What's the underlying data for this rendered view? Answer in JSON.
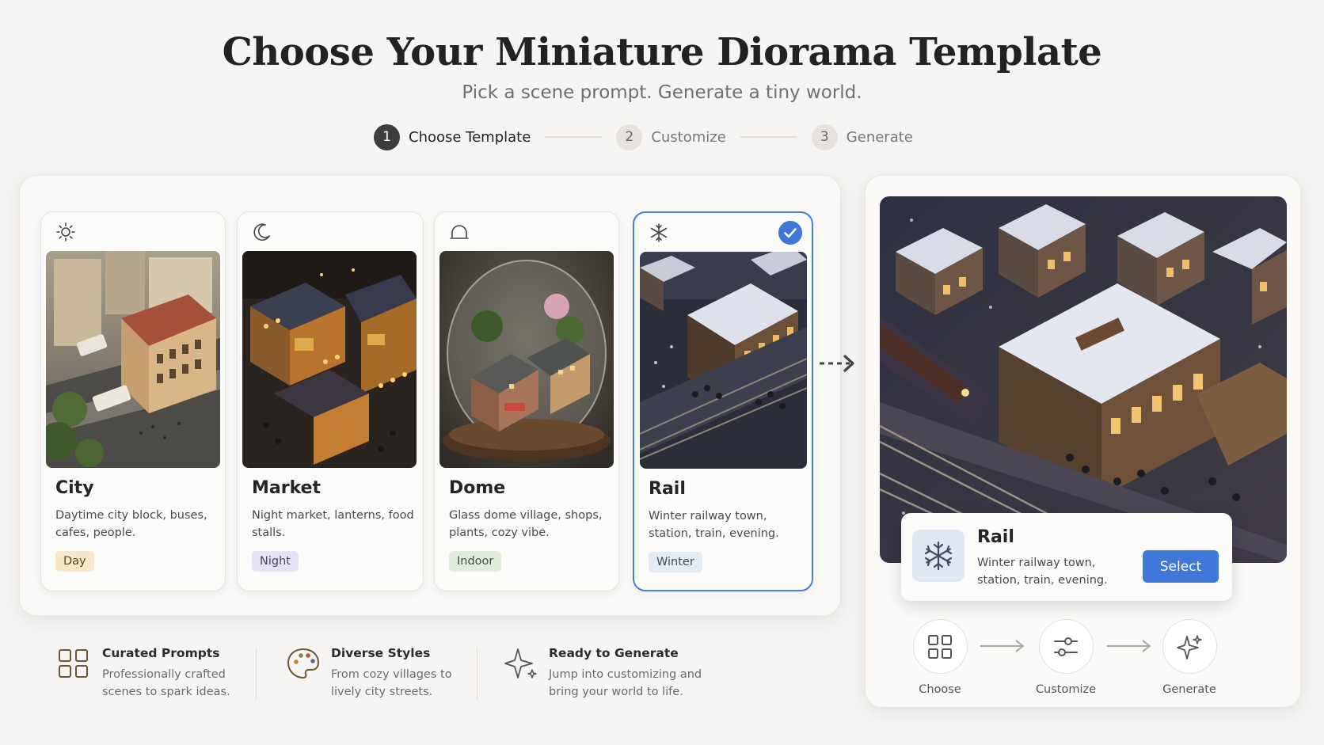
{
  "header": {
    "title": "Choose Your Miniature Diorama Template",
    "subtitle": "Pick a scene prompt. Generate a tiny world."
  },
  "stepper": {
    "steps": [
      {
        "number": "1",
        "label": "Choose Template",
        "active": true
      },
      {
        "number": "2",
        "label": "Customize",
        "active": false
      },
      {
        "number": "3",
        "label": "Generate",
        "active": false
      }
    ]
  },
  "templates": [
    {
      "icon": "sun-icon",
      "name": "City",
      "description": "Daytime city block, buses, cafes, people.",
      "tag": "Day",
      "tag_bg": "#f8e8c8",
      "tag_color": "#5a4420",
      "selected": false
    },
    {
      "icon": "moon-icon",
      "name": "Market",
      "description": "Night market, lanterns, food stalls.",
      "tag": "Night",
      "tag_bg": "#e6e4f4",
      "tag_color": "#444466",
      "selected": false
    },
    {
      "icon": "dome-bell-icon",
      "name": "Dome",
      "description": "Glass dome village, shops, plants, cozy vibe.",
      "tag": "Indoor",
      "tag_bg": "#e3ecdc",
      "tag_color": "#3d5236",
      "selected": false
    },
    {
      "icon": "snowflake-icon",
      "name": "Rail",
      "description": "Winter railway town, station, train, evening.",
      "tag": "Winter",
      "tag_bg": "#e4ebf3",
      "tag_color": "#3e4a58",
      "selected": true
    }
  ],
  "preview": {
    "name": "Rail",
    "description": "Winter railway town, station, train, evening.",
    "select_label": "Select",
    "flow": [
      {
        "icon": "grid-icon",
        "label": "Choose"
      },
      {
        "icon": "sliders-icon",
        "label": "Customize"
      },
      {
        "icon": "sparkle-icon",
        "label": "Generate"
      }
    ]
  },
  "features": [
    {
      "icon": "grid-icon",
      "title": "Curated Prompts",
      "description": "Professionally crafted scenes to spark ideas."
    },
    {
      "icon": "palette-icon",
      "title": "Diverse Styles",
      "description": "From cozy villages to lively city streets."
    },
    {
      "icon": "sparkle-icon",
      "title": "Ready to Generate",
      "description": "Jump into customizing and bring your world to life."
    }
  ],
  "colors": {
    "accent": "#3f78d8",
    "selected_border": "#4a7fd4",
    "step_active": "#3d3d3d"
  }
}
